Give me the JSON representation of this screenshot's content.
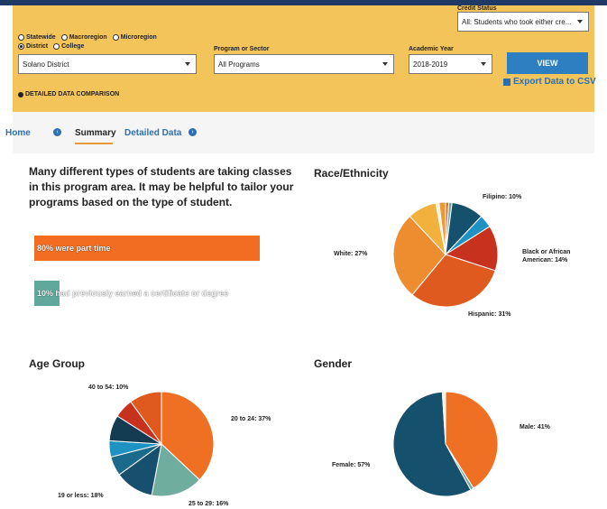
{
  "filters": {
    "credit_status_label": "Credit Status",
    "credit_status_value": "All: Students who took either cre...",
    "regions": [
      "Statewide",
      "Macroregion",
      "Microregion"
    ],
    "scopes": [
      "District",
      "College"
    ],
    "district_value": "Solano District",
    "program_label": "Program or Sector",
    "program_value": "All Programs",
    "year_label": "Academic Year",
    "year_value": "2018-2019",
    "view_label": "VIEW",
    "export_label": "Export Data to CSV",
    "detailed_label": "DETAILED DATA COMPARISON"
  },
  "nav": {
    "home": "Home",
    "summary": "Summary",
    "detailed": "Detailed Data"
  },
  "summary": {
    "intro": "Many different types of students are taking classes in this program area. It may be helpful to tailor your programs based on the type of student.",
    "part_time": "80% were part time",
    "part_time_value": 80,
    "certificate": "10% had previously earned a certificate or degree",
    "certificate_value": 10
  },
  "charts": {
    "race_title": "Race/Ethnicity",
    "age_title": "Age Group",
    "gender_title": "Gender"
  },
  "chart_data": [
    {
      "type": "pie",
      "title": "Race/Ethnicity",
      "labels": [
        "Filipino: 10%",
        "Black or African American: 14%",
        "Hispanic: 31%",
        "White: 27%"
      ],
      "slices": [
        {
          "label": "",
          "value": 1,
          "color": "#e86a2c"
        },
        {
          "label": "",
          "value": 1,
          "color": "#6fae9f"
        },
        {
          "label": "Filipino",
          "value": 10,
          "color": "#15506d"
        },
        {
          "label": "",
          "value": 4,
          "color": "#1d92c3"
        },
        {
          "label": "Black or African American",
          "value": 14,
          "color": "#c7321f"
        },
        {
          "label": "Hispanic",
          "value": 31,
          "color": "#de5a1f"
        },
        {
          "label": "White",
          "value": 27,
          "color": "#ee8d2f"
        },
        {
          "label": "",
          "value": 9,
          "color": "#f2b13d"
        },
        {
          "label": "",
          "value": 1,
          "color": "#f7f0dc"
        },
        {
          "label": "",
          "value": 2,
          "color": "#e89a36"
        }
      ]
    },
    {
      "type": "pie",
      "title": "Age Group",
      "labels": [
        "20 to 24: 37%",
        "25 to 29: 16%",
        "19 or less: 18%",
        "40 to 54: 10%"
      ],
      "slices": [
        {
          "label": "20 to 24",
          "value": 37,
          "color": "#f07023"
        },
        {
          "label": "25 to 29",
          "value": 16,
          "color": "#6fae9f"
        },
        {
          "label": "",
          "value": 12,
          "color": "#174f6e"
        },
        {
          "label": "19 or less",
          "value": 6,
          "color": "#1b6a8c"
        },
        {
          "label": "",
          "value": 5,
          "color": "#1d92c3"
        },
        {
          "label": "",
          "value": 8,
          "color": "#133b52"
        },
        {
          "label": "",
          "value": 6,
          "color": "#c7321f"
        },
        {
          "label": "40 to 54",
          "value": 10,
          "color": "#de5a1f"
        }
      ]
    },
    {
      "type": "pie",
      "title": "Gender",
      "labels": [
        "Male: 41%",
        "Female: 57%"
      ],
      "slices": [
        {
          "label": "Male",
          "value": 41,
          "color": "#f07023"
        },
        {
          "label": "",
          "value": 1,
          "color": "#6fae9f"
        },
        {
          "label": "Female",
          "value": 57,
          "color": "#15506d"
        },
        {
          "label": "",
          "value": 1,
          "color": "#f7f0dc"
        }
      ]
    }
  ]
}
